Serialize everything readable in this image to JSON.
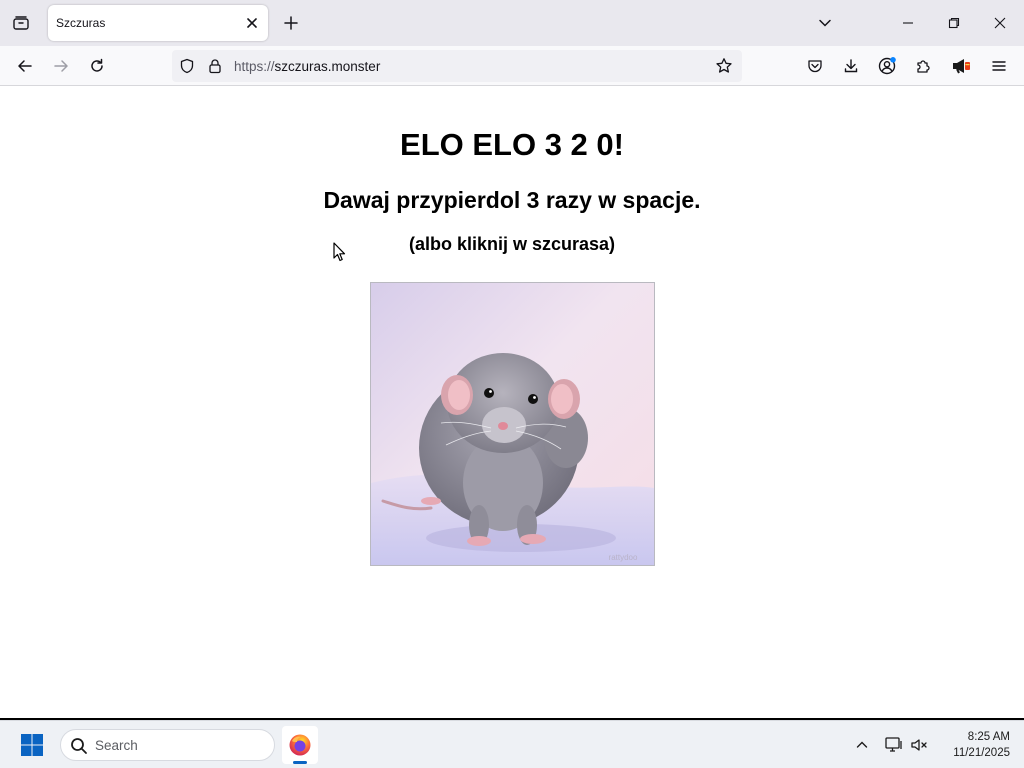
{
  "browser": {
    "tab": {
      "title": "Szczuras"
    },
    "url": {
      "scheme": "https://",
      "host": "szczuras.monster"
    }
  },
  "page": {
    "heading": "ELO ELO 3 2 0!",
    "subheading": "Dawaj przypierdol 3 razy w spacje.",
    "hint": "(albo kliknij w szcurasa)",
    "image": {
      "subject": "rat photo",
      "watermark": "rattydoo"
    }
  },
  "taskbar": {
    "search_placeholder": "Search",
    "time": "8:25 AM",
    "date": "11/21/2025"
  },
  "colors": {
    "tabstrip_bg": "#e9e8ee",
    "navbar_bg": "#f9f9fb",
    "urlbar_bg": "#f0f0f4",
    "taskbar_bg": "#eef1f5",
    "windows_blue": "#0a64c2"
  },
  "icons": {
    "tab_list": "tab-list-icon",
    "tab_close": "close-icon",
    "new_tab": "plus-icon",
    "back": "arrow-left-icon",
    "forward": "arrow-right-icon",
    "reload": "reload-icon",
    "tracking_protection": "shield-icon",
    "secure": "lock-icon",
    "bookmark": "star-icon",
    "pocket": "pocket-icon",
    "downloads": "download-icon",
    "account": "account-icon",
    "extensions": "puzzle-icon",
    "extension_speaker": "megaphone-icon",
    "menu": "hamburger-icon"
  }
}
